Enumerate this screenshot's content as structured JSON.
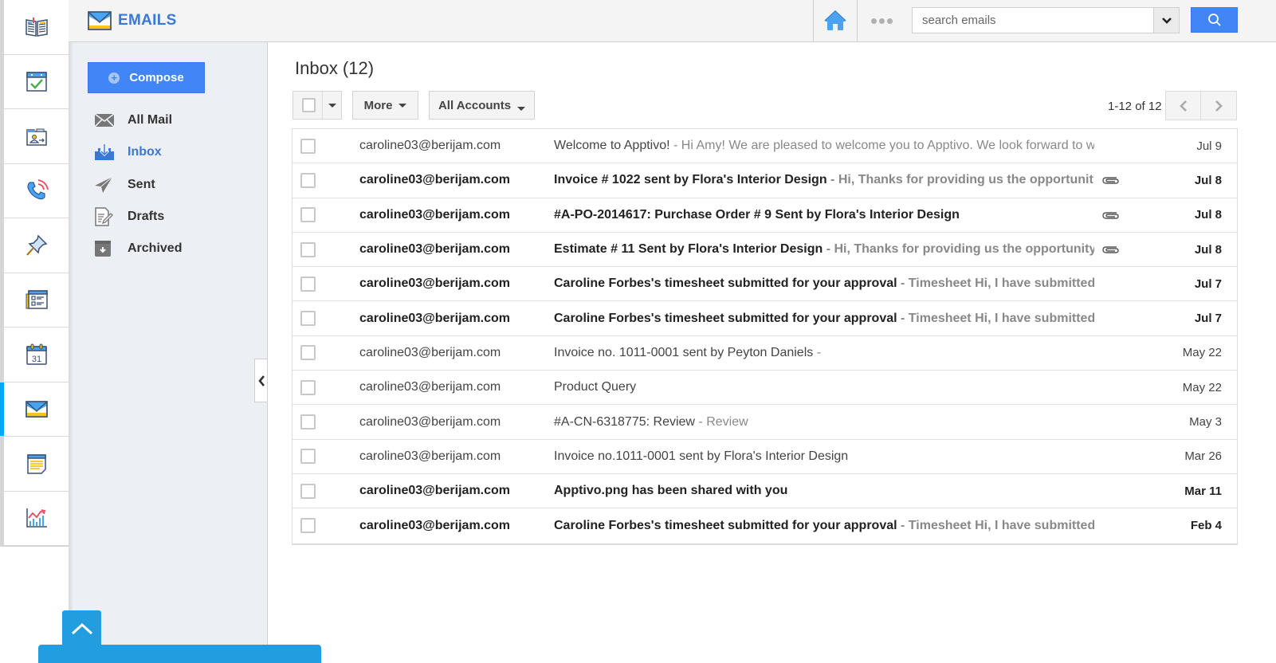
{
  "app": {
    "title": "EMAILS",
    "colors": {
      "accent": "#4285f4",
      "brand_text": "#3a78d6",
      "rail_active": "#03a9f4",
      "floating": "#229ddf"
    }
  },
  "rail": {
    "items": [
      {
        "name": "book-icon",
        "label": "Knowledge Base"
      },
      {
        "name": "calendar-check-icon",
        "label": "Tasks"
      },
      {
        "name": "contact-folder-icon",
        "label": "Contacts"
      },
      {
        "name": "phone-icon",
        "label": "Call Logs"
      },
      {
        "name": "pin-icon",
        "label": "Pins"
      },
      {
        "name": "form-icon",
        "label": "Forms"
      },
      {
        "name": "calendar-31-icon",
        "label": "Calendar"
      },
      {
        "name": "envelope-icon",
        "label": "Emails",
        "active": true
      },
      {
        "name": "notes-icon",
        "label": "Notes"
      },
      {
        "name": "chart-icon",
        "label": "Reports"
      }
    ]
  },
  "header": {
    "search_placeholder": "search emails",
    "home_icon": "home-icon",
    "more_icon": "more-dots-icon",
    "search_icon": "search-icon"
  },
  "leftnav": {
    "compose_label": "Compose",
    "folders": [
      {
        "label": "All Mail",
        "icon": "all-mail-icon"
      },
      {
        "label": "Inbox",
        "icon": "inbox-icon",
        "active": true
      },
      {
        "label": "Sent",
        "icon": "sent-icon"
      },
      {
        "label": "Drafts",
        "icon": "drafts-icon"
      },
      {
        "label": "Archived",
        "icon": "archived-icon"
      }
    ]
  },
  "main": {
    "title": "Inbox (12)",
    "toolbar": {
      "more_label": "More",
      "accounts_label": "All Accounts"
    },
    "pager": {
      "text": "1-12 of 12"
    },
    "emails": [
      {
        "from": "caroline03@berijam.com",
        "subject": "Welcome to Apptivo!",
        "snippet": " - Hi Amy! We are pleased to welcome you to Apptivo. We look forward to w",
        "date": "Jul 9",
        "unread": false,
        "attachment": false
      },
      {
        "from": "caroline03@berijam.com",
        "subject": "Invoice # 1022 sent by Flora's Interior Design",
        "snippet": " - Hi,  Thanks for providing us the opportunit",
        "date": "Jul 8",
        "unread": true,
        "attachment": true
      },
      {
        "from": "caroline03@berijam.com",
        "subject": "#A-PO-2014617: Purchase Order # 9 Sent by Flora's Interior Design",
        "snippet": "",
        "date": "Jul 8",
        "unread": true,
        "attachment": true
      },
      {
        "from": "caroline03@berijam.com",
        "subject": "Estimate # 11 Sent by Flora's Interior Design",
        "snippet": " - Hi,  Thanks for providing us the opportunity",
        "date": "Jul 8",
        "unread": true,
        "attachment": true
      },
      {
        "from": "caroline03@berijam.com",
        "subject": "Caroline Forbes's timesheet submitted for your approval",
        "snippet": " - Timesheet Hi, I have submitted",
        "date": "Jul 7",
        "unread": true,
        "attachment": false
      },
      {
        "from": "caroline03@berijam.com",
        "subject": "Caroline Forbes's timesheet submitted for your approval",
        "snippet": " - Timesheet Hi, I have submitted",
        "date": "Jul 7",
        "unread": true,
        "attachment": false
      },
      {
        "from": "caroline03@berijam.com",
        "subject": "Invoice no. 1011-0001 sent by Peyton Daniels",
        "snippet": " -",
        "date": "May 22",
        "unread": false,
        "attachment": false
      },
      {
        "from": "caroline03@berijam.com",
        "subject": "Product Query",
        "snippet": "",
        "date": "May 22",
        "unread": false,
        "attachment": false
      },
      {
        "from": "caroline03@berijam.com",
        "subject": "#A-CN-6318775: Review",
        "snippet": " - Review",
        "date": "May 3",
        "unread": false,
        "attachment": false
      },
      {
        "from": "caroline03@berijam.com",
        "subject": "Invoice no.1011-0001 sent by Flora's Interior Design",
        "snippet": "",
        "date": "Mar 26",
        "unread": false,
        "attachment": false
      },
      {
        "from": "caroline03@berijam.com",
        "subject": "Apptivo.png has been shared with you",
        "snippet": "",
        "date": "Mar 11",
        "unread": true,
        "attachment": false
      },
      {
        "from": "caroline03@berijam.com",
        "subject": "Caroline Forbes's timesheet submitted for your approval",
        "snippet": " - Timesheet Hi, I have submitted",
        "date": "Feb 4",
        "unread": true,
        "attachment": false
      }
    ]
  }
}
